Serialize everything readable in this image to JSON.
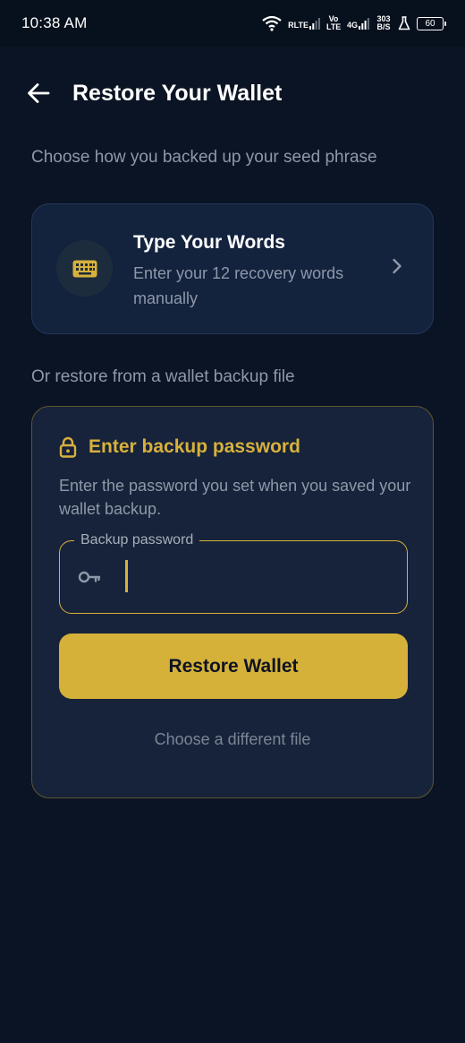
{
  "status_bar": {
    "time": "10:38 AM",
    "network_1": "RLTE",
    "volte": "Vo LTE",
    "network_2": "4G",
    "speed": "303 B/S",
    "battery": "60"
  },
  "header": {
    "back_icon": "arrow-left-icon",
    "title": "Restore Your Wallet"
  },
  "choose_hint": "Choose how you backed up your seed phrase",
  "type_words_card": {
    "icon": "keyboard-icon",
    "title": "Type Your Words",
    "subtitle": "Enter your 12 recovery words manually",
    "chevron_icon": "chevron-right-icon"
  },
  "restore_hint": "Or restore from a wallet backup file",
  "backup_card": {
    "lock_icon": "lock-icon",
    "title": "Enter backup password",
    "description": "Enter the password you set when you saved your wallet backup.",
    "password_field": {
      "label": "Backup password",
      "value": "",
      "icon": "key-icon"
    },
    "restore_button": "Restore Wallet",
    "different_file_link": "Choose a different file"
  },
  "colors": {
    "background": "#0b1424",
    "accent": "#d5b13a",
    "card": "#13223d",
    "muted_text": "#8e98a8"
  }
}
